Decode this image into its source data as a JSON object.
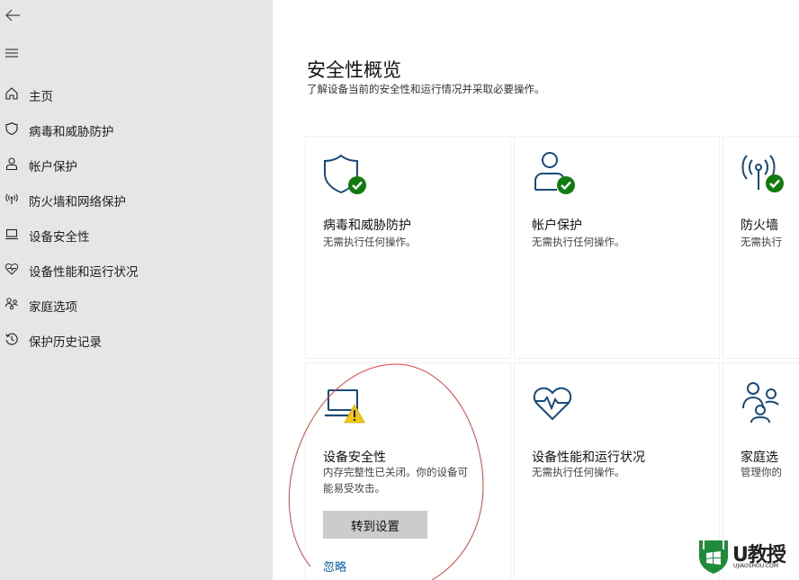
{
  "sidebar": {
    "items": [
      {
        "label": "主页",
        "icon": "home-icon"
      },
      {
        "label": "病毒和威胁防护",
        "icon": "shield-icon"
      },
      {
        "label": "帐户保护",
        "icon": "person-icon"
      },
      {
        "label": "防火墙和网络保护",
        "icon": "wifi-antenna-icon"
      },
      {
        "label": "设备安全性",
        "icon": "laptop-icon"
      },
      {
        "label": "设备性能和运行状况",
        "icon": "heart-pulse-icon"
      },
      {
        "label": "家庭选项",
        "icon": "family-icon"
      },
      {
        "label": "保护历史记录",
        "icon": "history-icon"
      }
    ]
  },
  "main": {
    "title": "安全性概览",
    "subtitle": "了解设备当前的安全性和运行情况并采取必要操作。",
    "cards": [
      {
        "title": "病毒和威胁防护",
        "desc": "无需执行任何操作。",
        "icon": "shield-check-icon"
      },
      {
        "title": "帐户保护",
        "desc": "无需执行任何操作。",
        "icon": "person-check-icon"
      },
      {
        "title": "防火墙",
        "desc": "无需执行",
        "icon": "antenna-check-icon"
      },
      {
        "title": "设备安全性",
        "desc_line1": "内存完整性已关闭。你的设备可",
        "desc_line2": "能易受攻击。",
        "button": "转到设置",
        "link": "忽略",
        "icon": "laptop-warning-icon"
      },
      {
        "title": "设备性能和运行状况",
        "desc": "无需执行任何操作。",
        "icon": "heart-pulse-icon"
      },
      {
        "title": "家庭选",
        "desc": "管理你的",
        "icon": "family-icon"
      }
    ]
  },
  "watermark": {
    "brand": "U教授",
    "site": "UJIAOSHOU.COM"
  },
  "colors": {
    "accent": "#0063b1",
    "ok_green": "#107c10",
    "warning_yellow": "#f2c811",
    "sidebar_bg": "#e6e6e6",
    "annotation": "#e4403c"
  }
}
